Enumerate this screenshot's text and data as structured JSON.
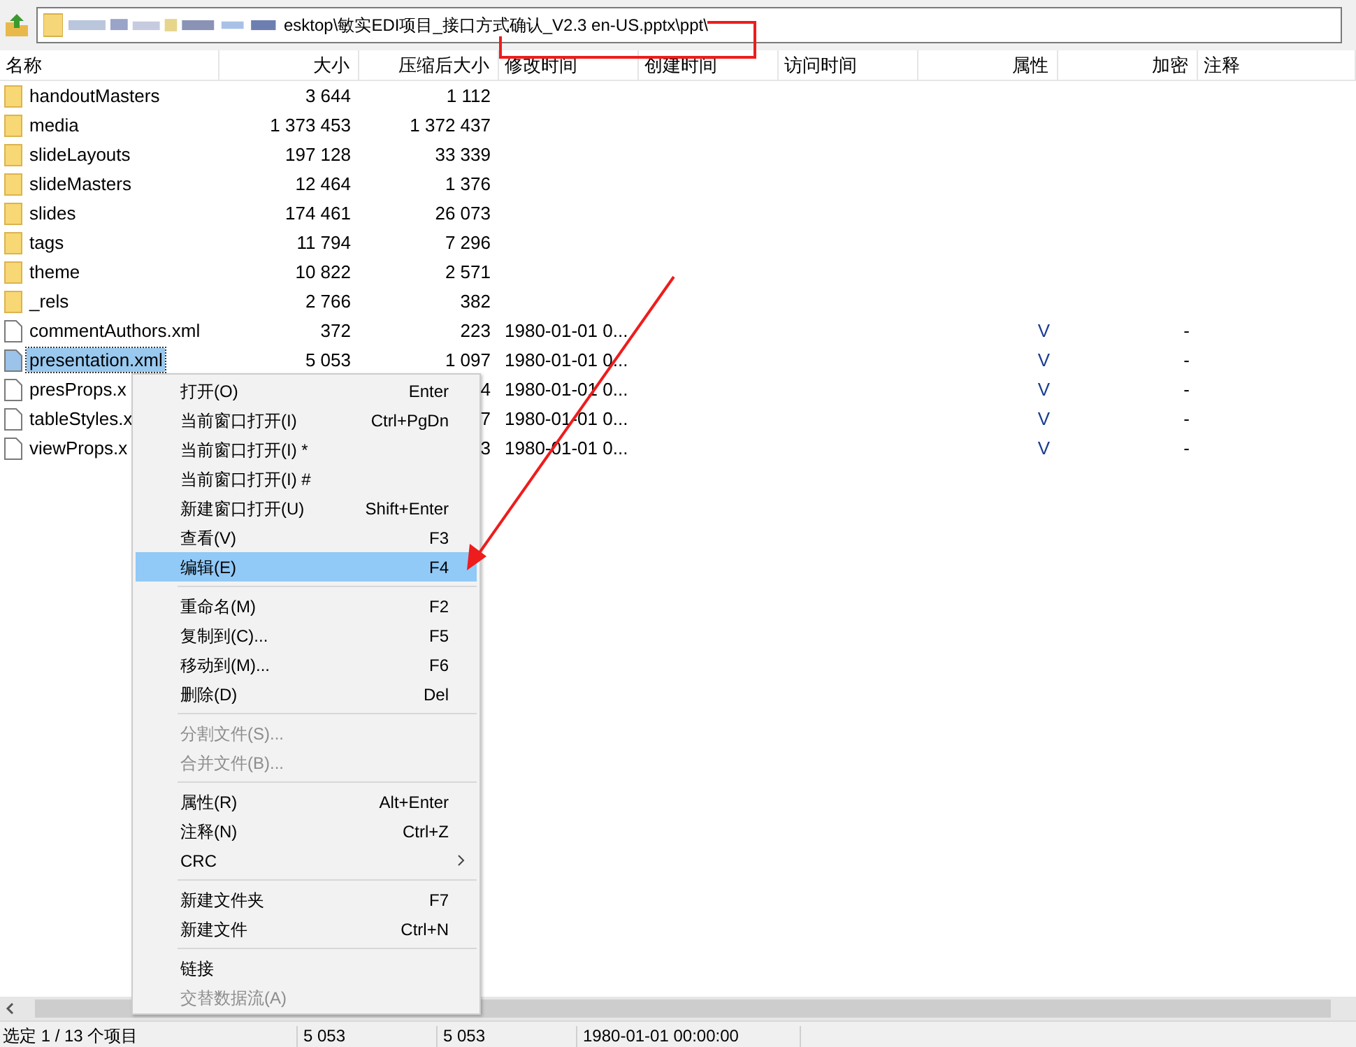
{
  "address": {
    "path": "esktop\\敏实EDI项目_接口方式确认_V2.3 en-US.pptx\\ppt\\"
  },
  "table": {
    "columns": [
      "名称",
      "大小",
      "压缩后大小",
      "修改时间",
      "创建时间",
      "访问时间",
      "属性",
      "加密",
      "注释"
    ],
    "rows": [
      {
        "kind": "folder",
        "name": "handoutMasters",
        "size": "3 644",
        "packed": "1 112",
        "selected": false
      },
      {
        "kind": "folder",
        "name": "media",
        "size": "1 373 453",
        "packed": "1 372 437",
        "selected": false
      },
      {
        "kind": "folder",
        "name": "slideLayouts",
        "size": "197 128",
        "packed": "33 339",
        "selected": false
      },
      {
        "kind": "folder",
        "name": "slideMasters",
        "size": "12 464",
        "packed": "1 376",
        "selected": false
      },
      {
        "kind": "folder",
        "name": "slides",
        "size": "174 461",
        "packed": "26 073",
        "selected": false
      },
      {
        "kind": "folder",
        "name": "tags",
        "size": "11 794",
        "packed": "7 296",
        "selected": false
      },
      {
        "kind": "folder",
        "name": "theme",
        "size": "10 822",
        "packed": "2 571",
        "selected": false
      },
      {
        "kind": "folder",
        "name": "_rels",
        "size": "2 766",
        "packed": "382",
        "selected": false
      },
      {
        "kind": "file",
        "name": "commentAuthors.xml",
        "size": "372",
        "packed": "223",
        "modified": "1980-01-01 0...",
        "attributes": "V",
        "encrypted": "-",
        "selected": false
      },
      {
        "kind": "file",
        "name": "presentation.xml",
        "size": "5 053",
        "packed": "1 097",
        "modified": "1980-01-01 0...",
        "attributes": "V",
        "encrypted": "-",
        "selected": true
      },
      {
        "kind": "file",
        "name": "presProps.x",
        "packed": "4",
        "modified": "1980-01-01 0...",
        "attributes": "V",
        "encrypted": "-",
        "selected": false
      },
      {
        "kind": "file",
        "name": "tableStyles.x",
        "packed": "7",
        "modified": "1980-01-01 0...",
        "attributes": "V",
        "encrypted": "-",
        "selected": false
      },
      {
        "kind": "file",
        "name": "viewProps.x",
        "packed": "3",
        "modified": "1980-01-01 0...",
        "attributes": "V",
        "encrypted": "-",
        "selected": false
      }
    ]
  },
  "context_menu": {
    "items": [
      {
        "kind": "item",
        "label": "打开(O)",
        "shortcut": "Enter",
        "disabled": false,
        "selected": false
      },
      {
        "kind": "item",
        "label": "当前窗口打开(I)",
        "shortcut": "Ctrl+PgDn",
        "disabled": false,
        "selected": false
      },
      {
        "kind": "item",
        "label": "当前窗口打开(I) *",
        "disabled": false,
        "selected": false
      },
      {
        "kind": "item",
        "label": "当前窗口打开(I) #",
        "disabled": false,
        "selected": false
      },
      {
        "kind": "item",
        "label": "新建窗口打开(U)",
        "shortcut": "Shift+Enter",
        "disabled": false,
        "selected": false
      },
      {
        "kind": "item",
        "label": "查看(V)",
        "shortcut": "F3",
        "disabled": false,
        "selected": false
      },
      {
        "kind": "item",
        "label": "编辑(E)",
        "shortcut": "F4",
        "disabled": false,
        "selected": true
      },
      {
        "kind": "separator"
      },
      {
        "kind": "item",
        "label": "重命名(M)",
        "shortcut": "F2",
        "disabled": false,
        "selected": false
      },
      {
        "kind": "item",
        "label": "复制到(C)...",
        "shortcut": "F5",
        "disabled": false,
        "selected": false
      },
      {
        "kind": "item",
        "label": "移动到(M)...",
        "shortcut": "F6",
        "disabled": false,
        "selected": false
      },
      {
        "kind": "item",
        "label": "删除(D)",
        "shortcut": "Del",
        "disabled": false,
        "selected": false
      },
      {
        "kind": "separator"
      },
      {
        "kind": "item",
        "label": "分割文件(S)...",
        "disabled": true,
        "selected": false
      },
      {
        "kind": "item",
        "label": "合并文件(B)...",
        "disabled": true,
        "selected": false
      },
      {
        "kind": "separator"
      },
      {
        "kind": "item",
        "label": "属性(R)",
        "shortcut": "Alt+Enter",
        "disabled": false,
        "selected": false
      },
      {
        "kind": "item",
        "label": "注释(N)",
        "shortcut": "Ctrl+Z",
        "disabled": false,
        "selected": false
      },
      {
        "kind": "submenu",
        "label": "CRC",
        "disabled": false,
        "selected": false
      },
      {
        "kind": "separator"
      },
      {
        "kind": "item",
        "label": "新建文件夹",
        "shortcut": "F7",
        "disabled": false,
        "selected": false
      },
      {
        "kind": "item",
        "label": "新建文件",
        "shortcut": "Ctrl+N",
        "disabled": false,
        "selected": false
      },
      {
        "kind": "separator"
      },
      {
        "kind": "item",
        "label": "链接",
        "disabled": false,
        "selected": false
      },
      {
        "kind": "item",
        "label": "交替数据流(A)",
        "disabled": true,
        "selected": false
      }
    ]
  },
  "status_bar": {
    "selection": "选定 1 / 13 个项目",
    "size": "5 053",
    "packed": "5 053",
    "modified": "1980-01-01 00:00:00"
  }
}
